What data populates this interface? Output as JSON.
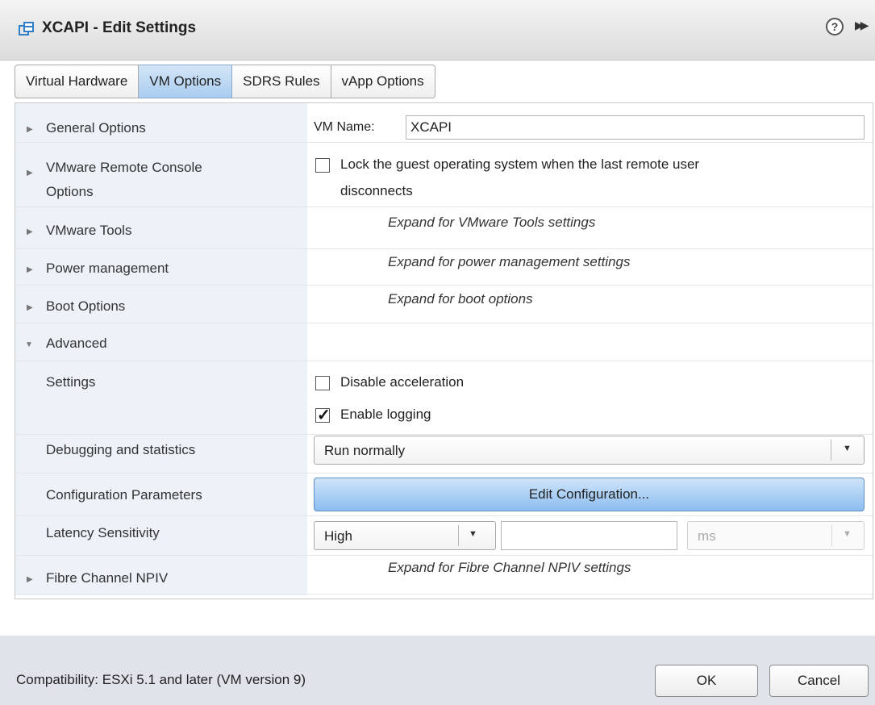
{
  "window": {
    "title": "XCAPI - Edit Settings",
    "help_glyph": "?",
    "expand_glyph": "▶▶"
  },
  "tabs": [
    {
      "label": "Virtual Hardware",
      "active": false
    },
    {
      "label": "VM Options",
      "active": true
    },
    {
      "label": "SDRS Rules",
      "active": false
    },
    {
      "label": "vApp Options",
      "active": false
    }
  ],
  "rows": {
    "general": {
      "label": "General Options",
      "field_label": "VM Name:",
      "field_value": "XCAPI"
    },
    "remote_console": {
      "label_line1": "VMware Remote Console",
      "label_line2": "Options",
      "checkbox_line1": "Lock the guest operating system when the last remote user",
      "checkbox_line2": "disconnects",
      "checked": false
    },
    "vmware_tools": {
      "label": "VMware Tools",
      "hint": "Expand for VMware Tools settings"
    },
    "power": {
      "label": "Power management",
      "hint": "Expand for power management settings"
    },
    "boot": {
      "label": "Boot Options",
      "hint": "Expand for boot options"
    },
    "advanced": {
      "label": "Advanced"
    },
    "settings": {
      "label": "Settings",
      "disable_accel": "Disable acceleration",
      "disable_accel_checked": false,
      "enable_logging": "Enable logging",
      "enable_logging_checked": true
    },
    "debugging": {
      "label": "Debugging and statistics",
      "value": "Run normally"
    },
    "config_params": {
      "label": "Configuration Parameters",
      "button": "Edit Configuration..."
    },
    "latency": {
      "label": "Latency Sensitivity",
      "value": "High",
      "amount": "",
      "unit": "ms"
    },
    "fibre": {
      "label": "Fibre Channel NPIV",
      "hint": "Expand for Fibre Channel NPIV settings"
    }
  },
  "footer": {
    "compatibility": "Compatibility: ESXi 5.1 and later (VM version 9)",
    "ok": "OK",
    "cancel": "Cancel"
  },
  "colors": {
    "accent_blue": "#a9ccf0",
    "left_column_bg": "#edf2f8",
    "footer_bg": "#e0e4ea"
  }
}
